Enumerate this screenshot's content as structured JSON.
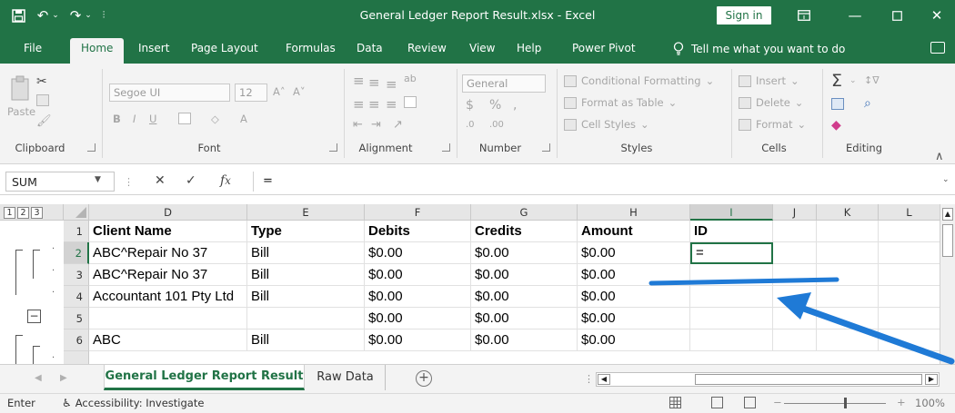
{
  "titlebar": {
    "title": "General Ledger Report Result.xlsx  -  Excel",
    "sign_in": "Sign in"
  },
  "tabs": [
    "File",
    "Home",
    "Insert",
    "Page Layout",
    "Formulas",
    "Data",
    "Review",
    "View",
    "Help",
    "Power Pivot"
  ],
  "active_tab": "Home",
  "tell_me": "Tell me what you want to do",
  "ribbon": {
    "clipboard": {
      "label": "Clipboard",
      "paste": "Paste"
    },
    "font": {
      "label": "Font",
      "name": "Segoe UI",
      "size": "12"
    },
    "alignment": {
      "label": "Alignment"
    },
    "number": {
      "label": "Number",
      "format": "General"
    },
    "styles": {
      "label": "Styles",
      "conditional": "Conditional Formatting",
      "format_table": "Format as Table",
      "cell_styles": "Cell Styles"
    },
    "cells": {
      "label": "Cells",
      "insert": "Insert",
      "delete": "Delete",
      "format": "Format"
    },
    "editing": {
      "label": "Editing"
    }
  },
  "formula_bar": {
    "name_box": "SUM",
    "formula": "="
  },
  "outline_levels": [
    "1",
    "2",
    "3"
  ],
  "columns": [
    "D",
    "E",
    "F",
    "G",
    "H",
    "I",
    "J",
    "K",
    "L"
  ],
  "selected_column": "I",
  "rows": [
    {
      "num": "1",
      "client": "Client Name",
      "type": "Type",
      "debits": "Debits",
      "credits": "Credits",
      "amount": "Amount",
      "id": "ID"
    },
    {
      "num": "2",
      "client": "ABC^Repair No 37",
      "type": "Bill",
      "debits": "$0.00",
      "credits": "$0.00",
      "amount": "$0.00",
      "id": "="
    },
    {
      "num": "3",
      "client": "ABC^Repair No 37",
      "type": "Bill",
      "debits": "$0.00",
      "credits": "$0.00",
      "amount": "$0.00",
      "id": ""
    },
    {
      "num": "4",
      "client": "Accountant 101 Pty Ltd",
      "type": "Bill",
      "debits": "$0.00",
      "credits": "$0.00",
      "amount": "$0.00",
      "id": ""
    },
    {
      "num": "5",
      "client": "",
      "type": "",
      "debits": "$0.00",
      "credits": "$0.00",
      "amount": "$0.00",
      "id": ""
    },
    {
      "num": "6",
      "client": "ABC",
      "type": "Bill",
      "debits": "$0.00",
      "credits": "$0.00",
      "amount": "$0.00",
      "id": ""
    }
  ],
  "selected_row": "2",
  "sheets": {
    "active": "General Ledger Report Result",
    "other": "Raw Data"
  },
  "status": {
    "mode": "Enter",
    "accessibility": "Accessibility: Investigate",
    "zoom": "100%"
  },
  "colors": {
    "excel_green": "#217346",
    "annotation_blue": "#1f7ad6"
  }
}
